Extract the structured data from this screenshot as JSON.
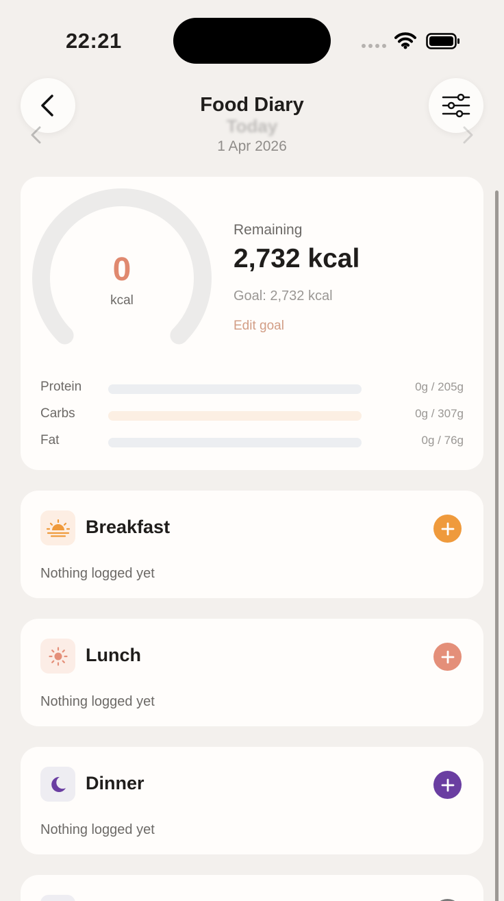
{
  "status_bar": {
    "time": "22:21"
  },
  "header": {
    "title": "Food Diary",
    "day_label": "Today",
    "date": "1 Apr 2026"
  },
  "summary": {
    "consumed": "0",
    "consumed_unit": "kcal",
    "consumed_fraction": 0,
    "remaining_label": "Remaining",
    "remaining_value": "2,732 kcal",
    "goal_text": "Goal: 2,732 kcal",
    "edit_goal_label": "Edit goal",
    "macros": [
      {
        "label": "Protein",
        "amount": "0g / 205g",
        "fraction": 0,
        "track_color": "#eceef1"
      },
      {
        "label": "Carbs",
        "amount": "0g / 307g",
        "fraction": 0,
        "track_color": "#fcefe3"
      },
      {
        "label": "Fat",
        "amount": "0g / 76g",
        "fraction": 0,
        "track_color": "#eceef1"
      }
    ]
  },
  "meals": [
    {
      "name": "Breakfast",
      "empty_text": "Nothing logged yet",
      "icon": "sunrise-icon",
      "accent": "#ef9a3c",
      "icon_bg": "#fdeee3"
    },
    {
      "name": "Lunch",
      "empty_text": "Nothing logged yet",
      "icon": "sun-icon",
      "accent": "#e48f79",
      "icon_bg": "#fcede6"
    },
    {
      "name": "Dinner",
      "empty_text": "Nothing logged yet",
      "icon": "moon-icon",
      "accent": "#6a3ea1",
      "icon_bg": "#eeedf2"
    }
  ],
  "colors": {
    "background": "#f3f0ed",
    "card": "#fffdfb",
    "calorie_accent": "#e0896f",
    "edit_goal": "#d29d85",
    "gauge_track": "#ecebea"
  }
}
